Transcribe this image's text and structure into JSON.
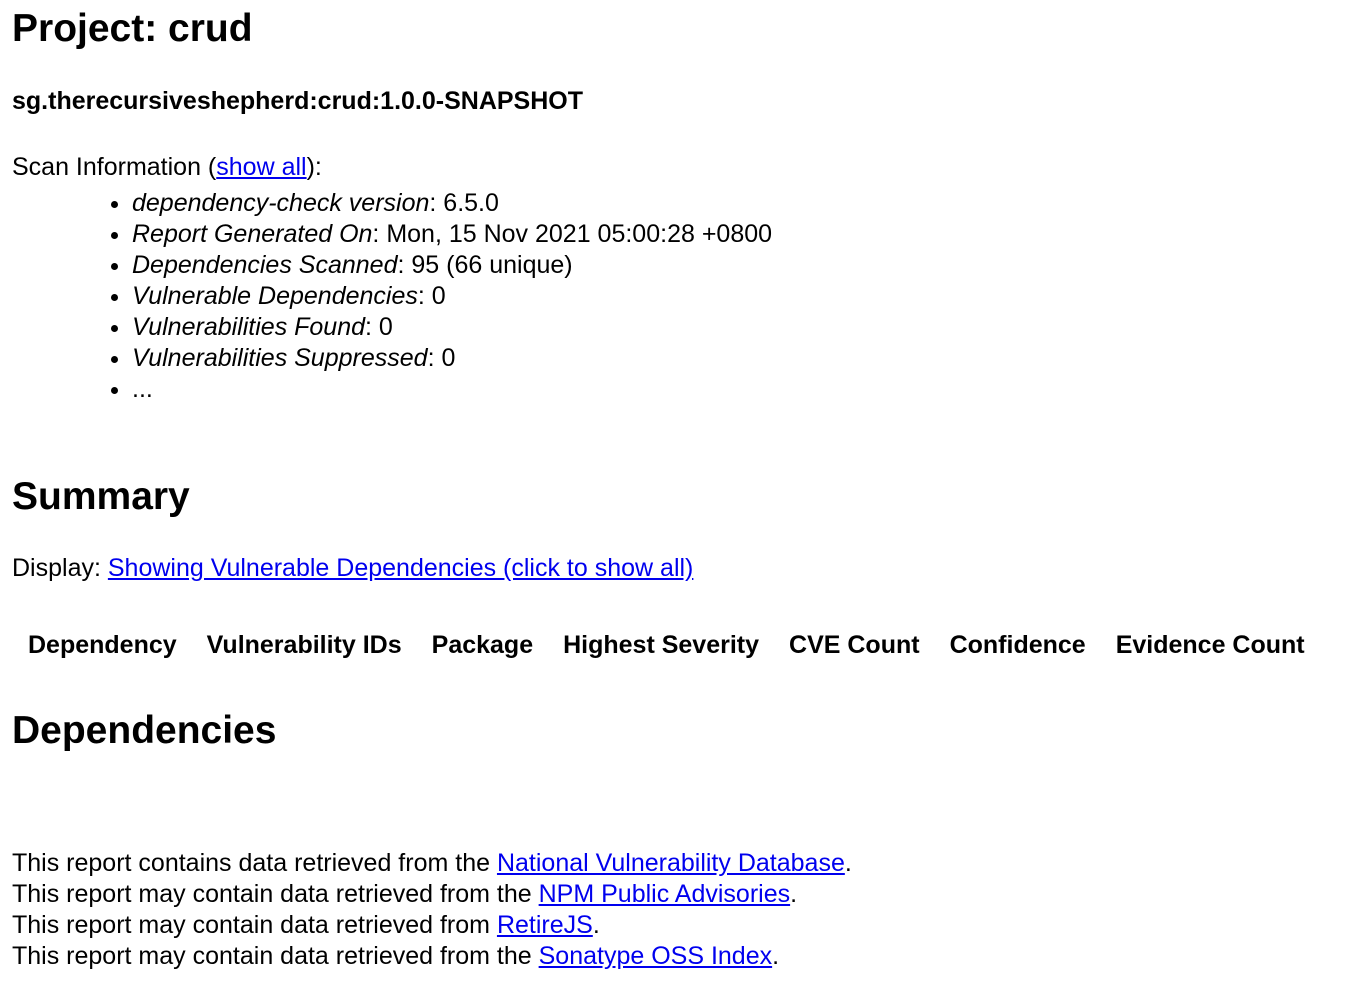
{
  "project": {
    "heading": "Project: crud",
    "artifact": "sg.therecursiveshepherd:crud:1.0.0-SNAPSHOT"
  },
  "scan_info": {
    "label_prefix": "Scan Information (",
    "show_all_link": "show all",
    "label_suffix": "):",
    "items": [
      {
        "key": "dependency-check version",
        "value": ": 6.5.0"
      },
      {
        "key": "Report Generated On",
        "value": ": Mon, 15 Nov 2021 05:00:28 +0800"
      },
      {
        "key": "Dependencies Scanned",
        "value": ": 95 (66 unique)"
      },
      {
        "key": "Vulnerable Dependencies",
        "value": ": 0"
      },
      {
        "key": "Vulnerabilities Found",
        "value": ": 0"
      },
      {
        "key": "Vulnerabilities Suppressed",
        "value": ": 0"
      },
      {
        "key": "",
        "value": "..."
      }
    ]
  },
  "summary": {
    "heading": "Summary",
    "display_label": "Display: ",
    "display_link": "Showing Vulnerable Dependencies (click to show all)",
    "columns": [
      "Dependency",
      "Vulnerability IDs",
      "Package",
      "Highest Severity",
      "CVE Count",
      "Confidence",
      "Evidence Count"
    ]
  },
  "dependencies": {
    "heading": "Dependencies"
  },
  "footer": {
    "lines": [
      {
        "prefix": "This report contains data retrieved from the ",
        "link": "National Vulnerability Database",
        "suffix": "."
      },
      {
        "prefix": "This report may contain data retrieved from the ",
        "link": "NPM Public Advisories",
        "suffix": "."
      },
      {
        "prefix": "This report may contain data retrieved from ",
        "link": "RetireJS",
        "suffix": "."
      },
      {
        "prefix": "This report may contain data retrieved from the ",
        "link": "Sonatype OSS Index",
        "suffix": "."
      }
    ]
  }
}
